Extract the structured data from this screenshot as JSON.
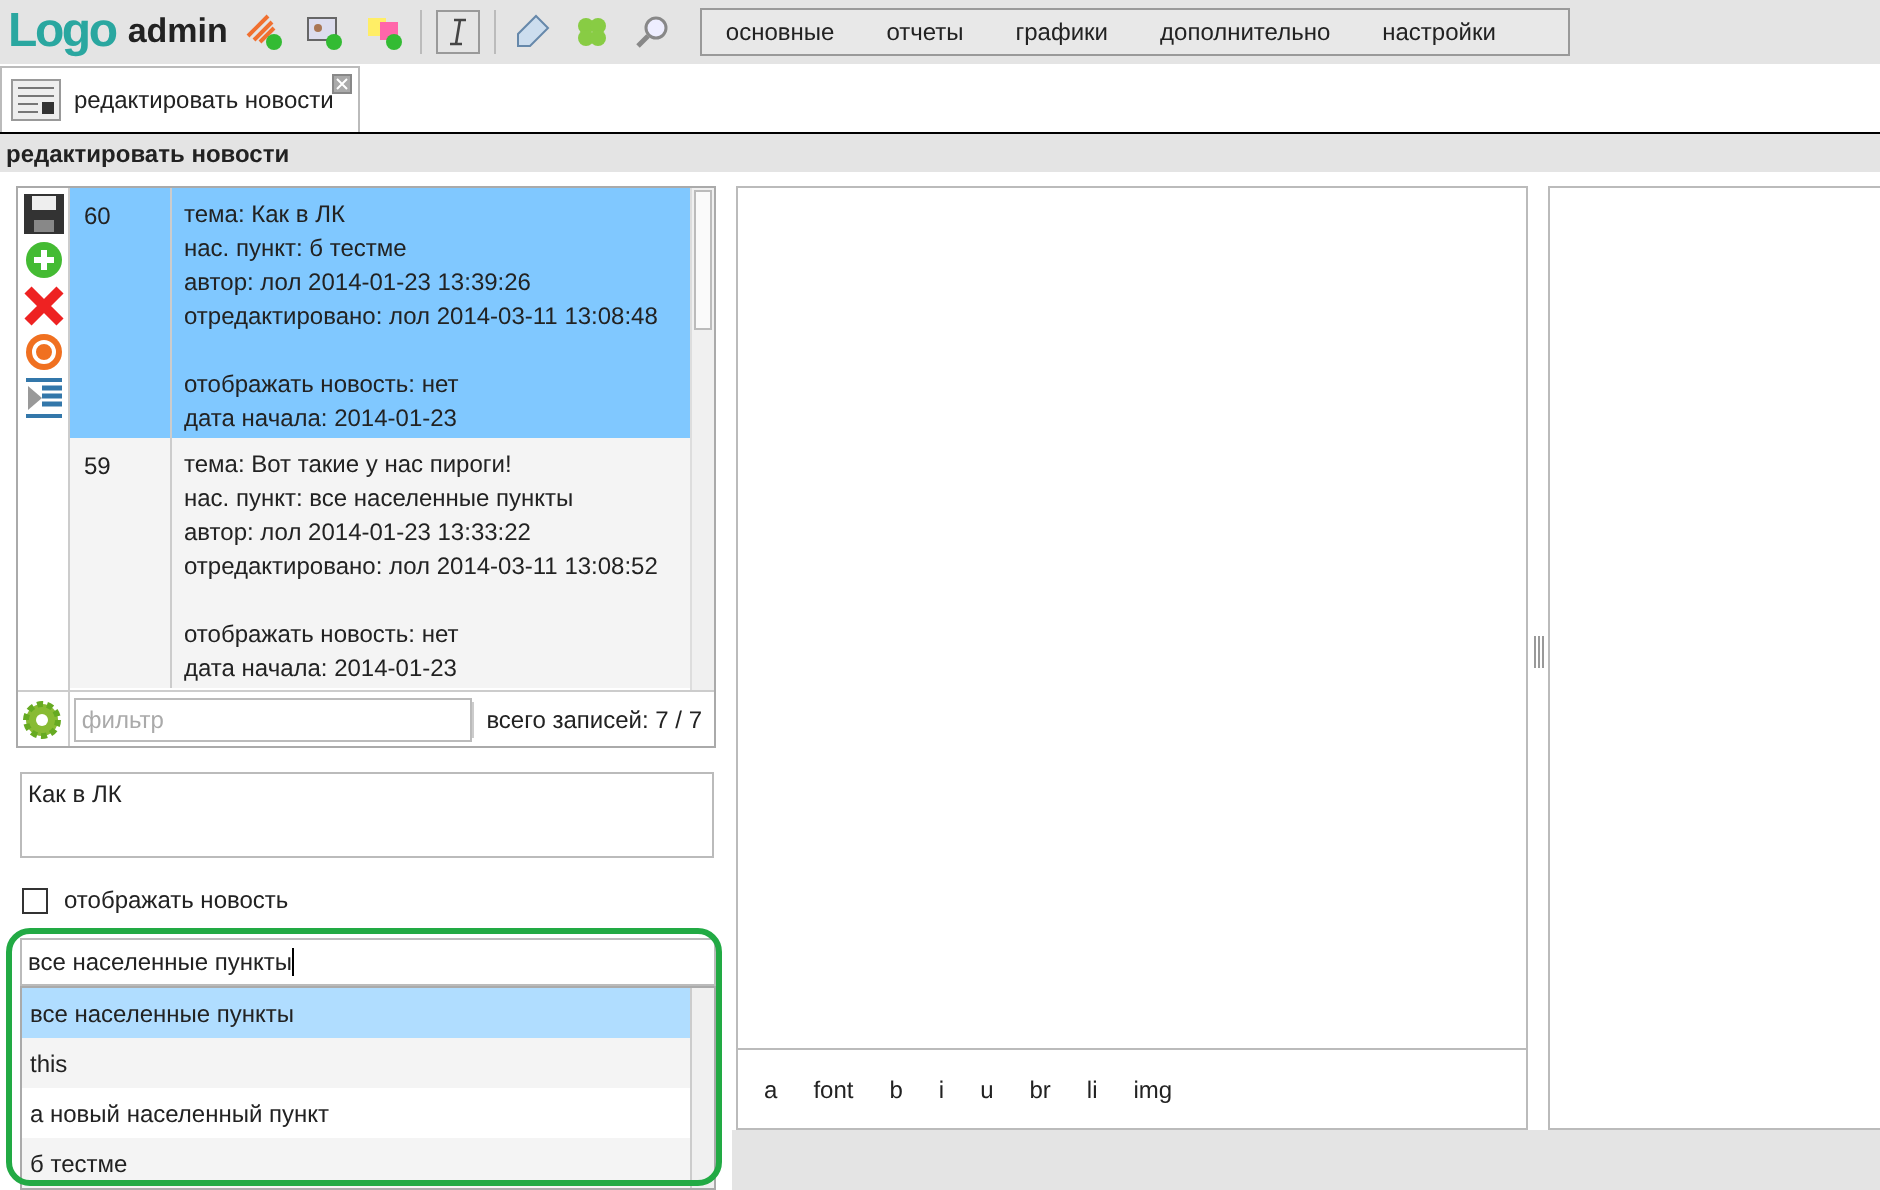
{
  "header": {
    "logo": "Logo",
    "user": "admin",
    "menu": [
      "основные",
      "отчеты",
      "графики",
      "дополнительно",
      "настройки"
    ]
  },
  "tabs": [
    {
      "label": "редактировать новости",
      "selected": true
    }
  ],
  "panel_title": "редактировать новости",
  "news_list": {
    "rows": [
      {
        "id": "60",
        "selected": true,
        "details": [
          "тема: Как в ЛК",
          "нас. пункт: б тестме",
          "автор: лол 2014-01-23 13:39:26",
          "отредактировано: лол 2014-03-11 13:08:48"
        ],
        "status": [
          "отображать новость: нет",
          "дата начала: 2014-01-23"
        ]
      },
      {
        "id": "59",
        "selected": false,
        "details": [
          "тема: Вот такие у нас пироги!",
          "нас. пункт: все населенные пункты",
          "автор: лол 2014-01-23 13:33:22",
          "отредактировано: лол 2014-03-11 13:08:52"
        ],
        "status": [
          "отображать новость: нет",
          "дата начала: 2014-01-23"
        ]
      }
    ],
    "filter": {
      "placeholder": "фильтр"
    },
    "total": "всего записей: 7 / 7"
  },
  "title_field": {
    "value": "Как в ЛК"
  },
  "show_news": {
    "label": "отображать новость",
    "checked": false
  },
  "locality": {
    "value": "все населенные пункты",
    "options": [
      {
        "label": "все населенные пункты",
        "selected": true
      },
      {
        "label": "this",
        "selected": false
      },
      {
        "label": "а новый населенный пункт",
        "selected": false
      },
      {
        "label": "б тестме",
        "selected": false
      }
    ]
  },
  "editor_tags": [
    "a",
    "font",
    "b",
    "i",
    "u",
    "br",
    "li",
    "img"
  ]
}
